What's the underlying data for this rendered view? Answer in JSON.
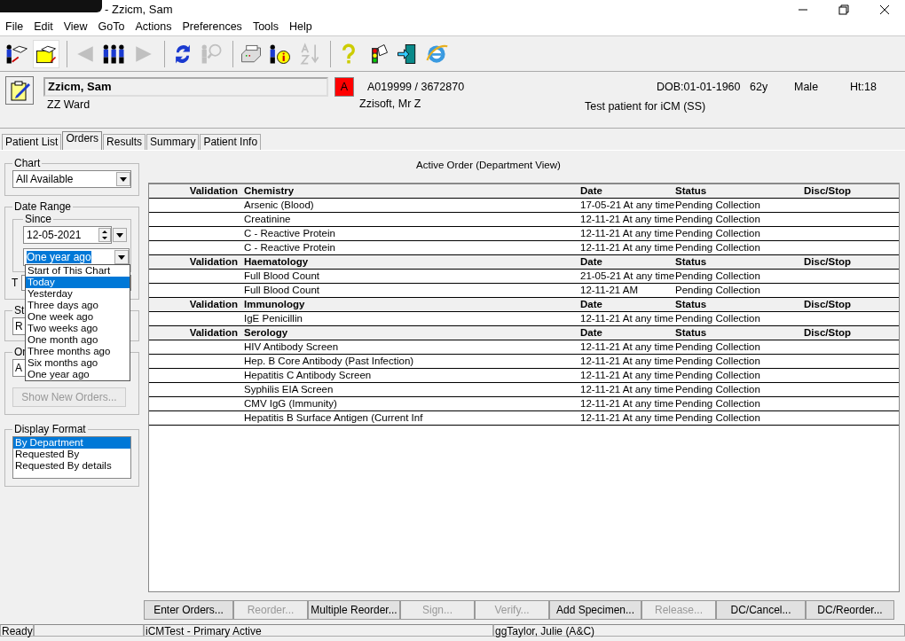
{
  "window": {
    "title": "- Zzicm, Sam"
  },
  "menu": [
    "File",
    "Edit",
    "View",
    "GoTo",
    "Actions",
    "Preferences",
    "Tools",
    "Help"
  ],
  "toolbar": [
    {
      "kind": "patients",
      "disabled": false,
      "selected": false
    },
    {
      "kind": "folder",
      "disabled": false,
      "selected": true
    },
    {
      "kind": "separator"
    },
    {
      "kind": "back",
      "disabled": true,
      "selected": false
    },
    {
      "kind": "people",
      "disabled": false,
      "selected": false
    },
    {
      "kind": "forward",
      "disabled": true,
      "selected": false
    },
    {
      "kind": "separator"
    },
    {
      "kind": "refresh",
      "disabled": false,
      "selected": false
    },
    {
      "kind": "search",
      "disabled": true,
      "selected": false
    },
    {
      "kind": "separator"
    },
    {
      "kind": "printer",
      "disabled": false,
      "selected": false
    },
    {
      "kind": "info",
      "disabled": false,
      "selected": false
    },
    {
      "kind": "sort",
      "disabled": true,
      "selected": false
    },
    {
      "kind": "separator"
    },
    {
      "kind": "help",
      "disabled": false,
      "selected": false
    },
    {
      "kind": "traffic",
      "disabled": false,
      "selected": false
    },
    {
      "kind": "exit",
      "disabled": false,
      "selected": false
    },
    {
      "kind": "browser",
      "disabled": false,
      "selected": false
    }
  ],
  "patient": {
    "name": "Zzicm, Sam",
    "ward": "ZZ Ward",
    "alert": "A",
    "number": "A019999 / 3672870",
    "consultant": "Zzisoft, Mr Z",
    "dob": "DOB:01-01-1960",
    "age": "62y",
    "sex": "Male",
    "height": "Ht:18",
    "note": "Test patient for iCM (SS)"
  },
  "tabs": [
    {
      "label": "Patient List",
      "selected": false
    },
    {
      "label": "Orders",
      "selected": true
    },
    {
      "label": "Results",
      "selected": false
    },
    {
      "label": "Summary",
      "selected": false
    },
    {
      "label": "Patient Info",
      "selected": false
    }
  ],
  "filters": {
    "chart": {
      "legend": "Chart",
      "value": "All Available"
    },
    "date_range": {
      "legend": "Date Range",
      "since_legend": "Since",
      "date": "12-05-2021",
      "period": "One year ago",
      "to_label": "T",
      "options": [
        {
          "label": "Start of This Chart",
          "selected": false
        },
        {
          "label": "Today",
          "selected": true
        },
        {
          "label": "Yesterday",
          "selected": false
        },
        {
          "label": "Three days ago",
          "selected": false
        },
        {
          "label": "One week ago",
          "selected": false
        },
        {
          "label": "Two weeks ago",
          "selected": false
        },
        {
          "label": "One month ago",
          "selected": false
        },
        {
          "label": "Three months ago",
          "selected": false
        },
        {
          "label": "Six months ago",
          "selected": false
        },
        {
          "label": "One year ago",
          "selected": false
        }
      ]
    },
    "status": {
      "legend": "St",
      "value": "R"
    },
    "order": {
      "legend": "Or",
      "value": "A",
      "button": "Show New Orders...",
      "button_disabled": true
    },
    "display_format": {
      "legend": "Display Format",
      "options": [
        {
          "label": "By Department",
          "selected": true
        },
        {
          "label": "Requested By",
          "selected": false
        },
        {
          "label": "Requested By details",
          "selected": false
        }
      ]
    }
  },
  "orders": {
    "caption": "Active Order (Department View)",
    "groups": [
      {
        "validation": "Validation",
        "department": "Chemistry",
        "date": "Date",
        "status": "Status",
        "disc": "Disc/Stop",
        "rows": [
          {
            "name": "Arsenic (Blood)",
            "date": "17-05-21 At any time",
            "status": "Pending Collection"
          },
          {
            "name": "Creatinine",
            "date": "12-11-21 At any time",
            "status": "Pending Collection"
          },
          {
            "name": "C - Reactive Protein",
            "date": "12-11-21 At any time",
            "status": "Pending Collection"
          },
          {
            "name": "C - Reactive Protein",
            "date": "12-11-21 At any time",
            "status": "Pending Collection"
          }
        ]
      },
      {
        "validation": "Validation",
        "department": "Haematology",
        "date": "Date",
        "status": "Status",
        "disc": "Disc/Stop",
        "rows": [
          {
            "name": "Full Blood Count",
            "date": "21-05-21 At any time",
            "status": "Pending Collection"
          },
          {
            "name": "Full Blood Count",
            "date": "12-11-21 AM",
            "status": "Pending Collection"
          }
        ]
      },
      {
        "validation": "Validation",
        "department": "Immunology",
        "date": "Date",
        "status": "Status",
        "disc": "Disc/Stop",
        "rows": [
          {
            "name": "IgE Penicillin",
            "date": "12-11-21 At any time",
            "status": "Pending Collection"
          }
        ]
      },
      {
        "validation": "Validation",
        "department": "Serology",
        "date": "Date",
        "status": "Status",
        "disc": "Disc/Stop",
        "rows": [
          {
            "name": "HIV Antibody Screen",
            "date": "12-11-21 At any time",
            "status": "Pending Collection"
          },
          {
            "name": "Hep. B Core Antibody (Past Infection)",
            "date": "12-11-21 At any time",
            "status": "Pending Collection"
          },
          {
            "name": "Hepatitis C Antibody Screen",
            "date": "12-11-21 At any time",
            "status": "Pending Collection"
          },
          {
            "name": "Syphilis EIA Screen",
            "date": "12-11-21 At any time",
            "status": "Pending Collection"
          },
          {
            "name": "CMV IgG (Immunity)",
            "date": "12-11-21 At any time",
            "status": "Pending Collection"
          },
          {
            "name": "Hepatitis B Surface Antigen (Current Inf",
            "date": "12-11-21 At any time",
            "status": "Pending Collection"
          }
        ]
      }
    ]
  },
  "buttons": [
    {
      "label": "Enter Orders...",
      "disabled": false
    },
    {
      "label": "Reorder...",
      "disabled": true
    },
    {
      "label": "Multiple Reorder...",
      "disabled": false
    },
    {
      "label": "Sign...",
      "disabled": true
    },
    {
      "label": "Verify...",
      "disabled": true
    },
    {
      "label": "Add Specimen...",
      "disabled": false
    },
    {
      "label": "Release...",
      "disabled": true
    },
    {
      "label": "DC/Cancel...",
      "disabled": false
    },
    {
      "label": "DC/Reorder...",
      "disabled": false
    }
  ],
  "status_bar": [
    "Ready",
    "iCMTest - Primary Active",
    "ggTaylor, Julie  (A&C)"
  ]
}
